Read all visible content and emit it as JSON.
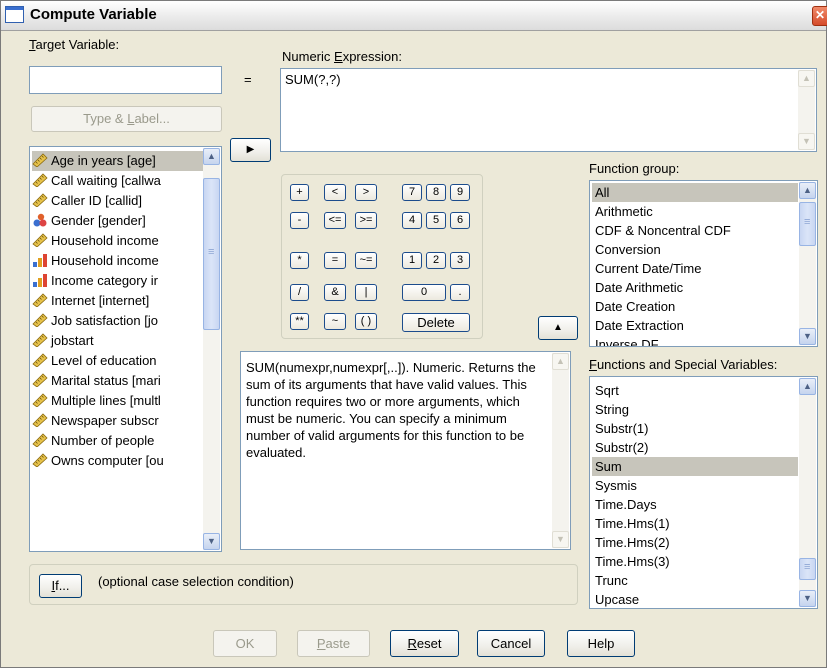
{
  "window": {
    "title": "Compute Variable",
    "close_glyph": "✕"
  },
  "target": {
    "label_mnemonic": "T",
    "label_rest": "arget Variable:",
    "value": "",
    "equals": "=",
    "type_label_button_pre": "Type & ",
    "type_label_button_mnemonic": "L",
    "type_label_button_post": "abel..."
  },
  "expression": {
    "label_pre": "Numeric ",
    "label_mnemonic": "E",
    "label_post": "xpression:",
    "value": "SUM(?,?)"
  },
  "variables": [
    {
      "label": "Age in years [age]",
      "icon": "ruler-icon"
    },
    {
      "label": "Call waiting [callwa",
      "icon": "ruler-icon"
    },
    {
      "label": "Caller ID [callid]",
      "icon": "ruler-icon"
    },
    {
      "label": "Gender [gender]",
      "icon": "nominal-icon"
    },
    {
      "label": "Household income",
      "icon": "ruler-icon"
    },
    {
      "label": "Household income",
      "icon": "ordinal-icon"
    },
    {
      "label": "Income category ir",
      "icon": "ordinal-icon"
    },
    {
      "label": "Internet [internet]",
      "icon": "ruler-icon"
    },
    {
      "label": "Job satisfaction [jo",
      "icon": "ruler-icon"
    },
    {
      "label": "jobstart",
      "icon": "ruler-icon"
    },
    {
      "label": "Level of education",
      "icon": "ruler-icon"
    },
    {
      "label": "Marital status [mari",
      "icon": "ruler-icon"
    },
    {
      "label": "Multiple lines [multl",
      "icon": "ruler-icon"
    },
    {
      "label": "Newspaper subscr",
      "icon": "ruler-icon"
    },
    {
      "label": "Number of people",
      "icon": "ruler-icon"
    },
    {
      "label": "Owns computer [ou",
      "icon": "ruler-icon"
    }
  ],
  "move_arrow": "▶",
  "keypad": {
    "row1": [
      "+",
      "<",
      ">",
      "7",
      "8",
      "9"
    ],
    "row2": [
      "-",
      "<=",
      ">=",
      "4",
      "5",
      "6"
    ],
    "row3": [
      "*",
      "=",
      "~=",
      "1",
      "2",
      "3"
    ],
    "row4": [
      "/",
      "&",
      "|",
      "0",
      "."
    ],
    "row5": [
      "**",
      "~",
      "( )",
      "Delete"
    ]
  },
  "insert_arrow": "▲",
  "description": "SUM(numexpr,numexpr[,..]). Numeric. Returns the sum of its arguments that have valid values. This function requires two or more arguments, which must be numeric. You can specify a minimum number of valid arguments for this function to be evaluated.",
  "function_group": {
    "label": "Function group:",
    "items": [
      "All",
      "Arithmetic",
      "CDF & Noncentral CDF",
      "Conversion",
      "Current Date/Time",
      "Date Arithmetic",
      "Date Creation",
      "Date Extraction",
      "Inverse DF"
    ],
    "selected": "All"
  },
  "functions": {
    "label_mnemonic": "F",
    "label_rest": "unctions and Special Variables:",
    "items": [
      "Sqrt",
      "String",
      "Substr(1)",
      "Substr(2)",
      "Sum",
      "Sysmis",
      "Time.Days",
      "Time.Hms(1)",
      "Time.Hms(2)",
      "Time.Hms(3)",
      "Trunc",
      "Upcase"
    ],
    "selected": "Sum"
  },
  "if": {
    "button_mnemonic": "I",
    "button_rest": "f...",
    "caption": "(optional case selection condition)"
  },
  "footer": {
    "ok": "OK",
    "paste_mnemonic": "P",
    "paste_rest": "aste",
    "reset_mnemonic": "R",
    "reset_rest": "eset",
    "cancel": "Cancel",
    "help": "Help"
  },
  "colors": {
    "face": "#ece9d8",
    "selection": "#c7c5bb",
    "border_blue": "#7f9db9"
  }
}
